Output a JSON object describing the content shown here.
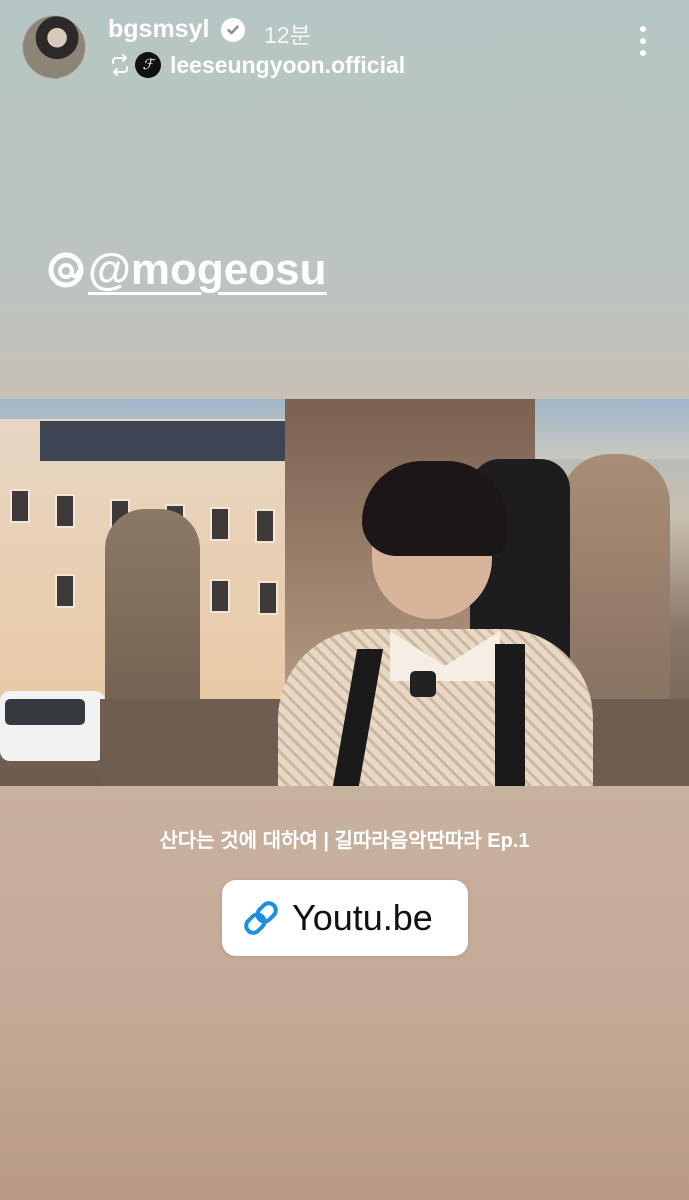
{
  "header": {
    "username": "bgsmsyl",
    "verified_icon": "verified-badge-icon",
    "time": "12분",
    "repost_icon": "repost-icon",
    "referenced_account": "leeseungyoon.official",
    "referenced_avatar_glyph": "ℱ",
    "more_icon": "more-vertical-icon"
  },
  "story": {
    "mention": "@mogeosu",
    "mention_icon": "threads-icon",
    "caption": "산다는 것에 대하여 | 길따라음악딴따라 Ep.1",
    "link_sticker": {
      "icon": "link-icon",
      "label": "Youtu.be",
      "icon_color": "#1d8fe1"
    }
  },
  "colors": {
    "top": "#b6c6c4",
    "bottom": "#b89a86",
    "sticker_bg": "#ffffff"
  }
}
